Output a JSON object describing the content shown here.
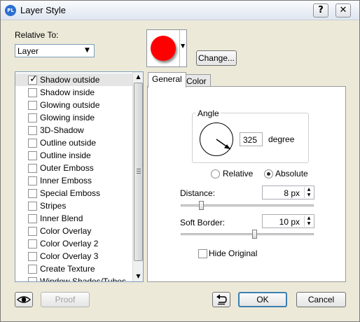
{
  "window": {
    "title": "Layer Style",
    "app_icon_text": "PL",
    "help_glyph": "?",
    "close_glyph": "✕"
  },
  "relative_to": {
    "label": "Relative To:",
    "selected": "Layer"
  },
  "color": {
    "value": "#ff0000",
    "change_button": "Change..."
  },
  "effects": {
    "items": [
      {
        "label": "Shadow outside",
        "checked": true
      },
      {
        "label": "Shadow inside",
        "checked": false
      },
      {
        "label": "Glowing outside",
        "checked": false
      },
      {
        "label": "Glowing inside",
        "checked": false
      },
      {
        "label": "3D-Shadow",
        "checked": false
      },
      {
        "label": "Outline outside",
        "checked": false
      },
      {
        "label": "Outline inside",
        "checked": false
      },
      {
        "label": "Outer Emboss",
        "checked": false
      },
      {
        "label": "Inner Emboss",
        "checked": false
      },
      {
        "label": "Special Emboss",
        "checked": false
      },
      {
        "label": "Stripes",
        "checked": false
      },
      {
        "label": "Inner Blend",
        "checked": false
      },
      {
        "label": "Color Overlay",
        "checked": false
      },
      {
        "label": "Color Overlay 2",
        "checked": false
      },
      {
        "label": "Color Overlay 3",
        "checked": false
      },
      {
        "label": "Create Texture",
        "checked": false
      },
      {
        "label": "Window Shades/Tubes",
        "checked": false
      }
    ]
  },
  "tabs": [
    {
      "label": "General",
      "active": true
    },
    {
      "label": "Color",
      "active": false
    }
  ],
  "general": {
    "angle_label": "Angle",
    "angle_value": "325",
    "angle_unit": "degree",
    "mode_relative": "Relative",
    "mode_absolute": "Absolute",
    "mode_selected": "Absolute",
    "distance_label": "Distance:",
    "distance_value": "8 px",
    "distance_slider_fraction": 0.15,
    "soft_border_label": "Soft Border:",
    "soft_border_value": "10 px",
    "soft_border_slider_fraction": 0.55,
    "hide_original_label": "Hide Original",
    "hide_original_checked": false
  },
  "footer": {
    "proof_label": "Proof",
    "ok_label": "OK",
    "cancel_label": "Cancel"
  }
}
